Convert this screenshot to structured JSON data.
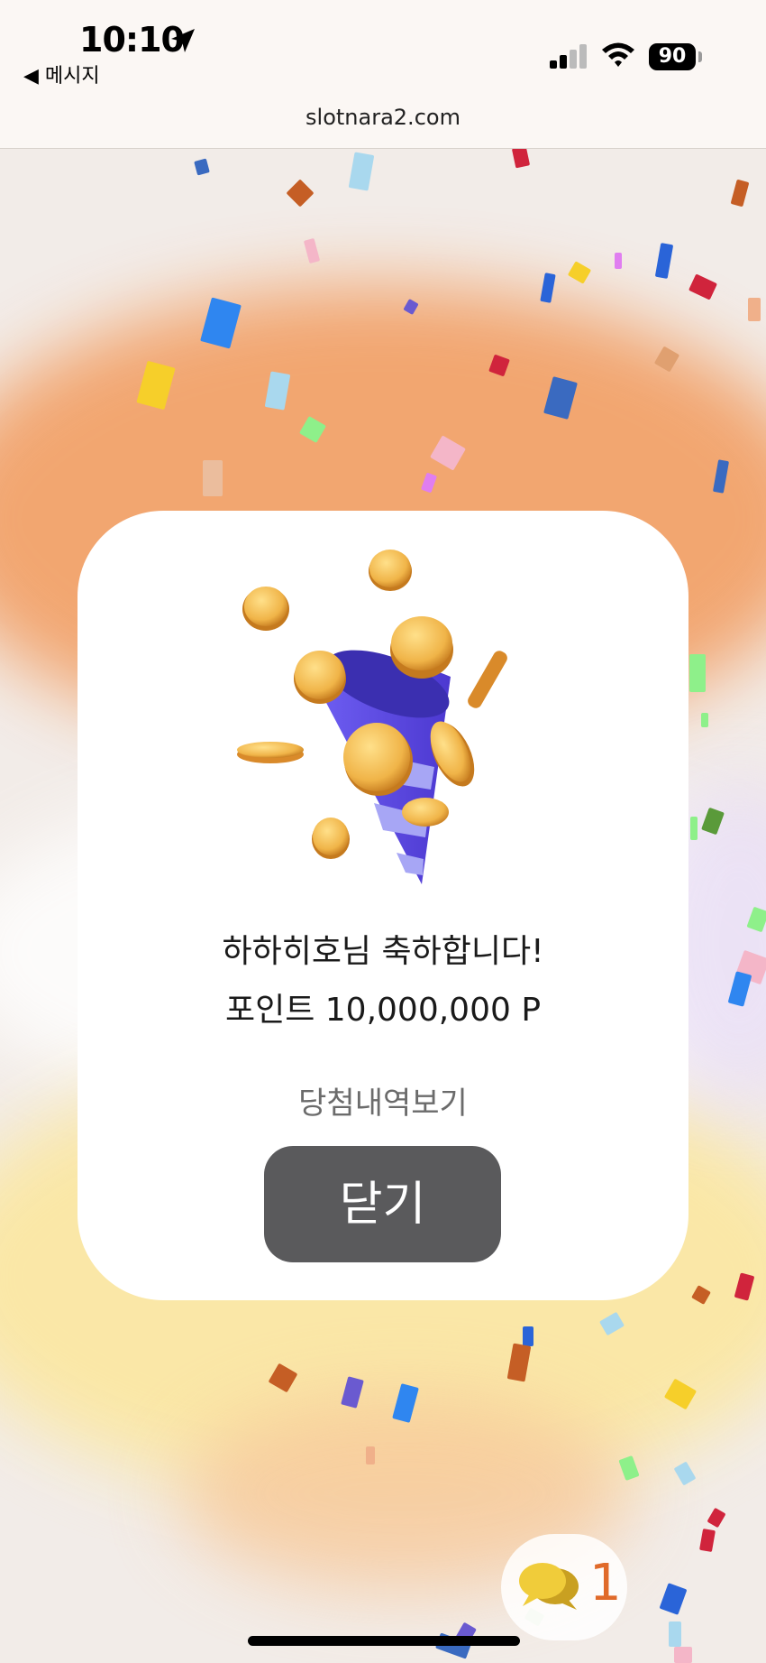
{
  "status_bar": {
    "time": "10:10",
    "back_label": "◀ 메시지",
    "battery": "90"
  },
  "browser": {
    "url": "slotnara2.com"
  },
  "modal": {
    "congrats_text": "하하히호님 축하합니다!",
    "points_text": "포인트 10,000,000 P",
    "history_link": "당첨내역보기",
    "close_button": "닫기"
  },
  "chat": {
    "unread_count": "1"
  },
  "icons": {
    "location": "location-arrow-icon",
    "signal": "cellular-signal-icon",
    "wifi": "wifi-icon",
    "battery": "battery-icon",
    "chat": "chat-bubbles-icon",
    "illustration": "party-popper-coins-icon"
  },
  "colors": {
    "button_bg": "#5a5a5c",
    "chat_count": "#e06a2a",
    "background_orange": "#f0a36a"
  }
}
